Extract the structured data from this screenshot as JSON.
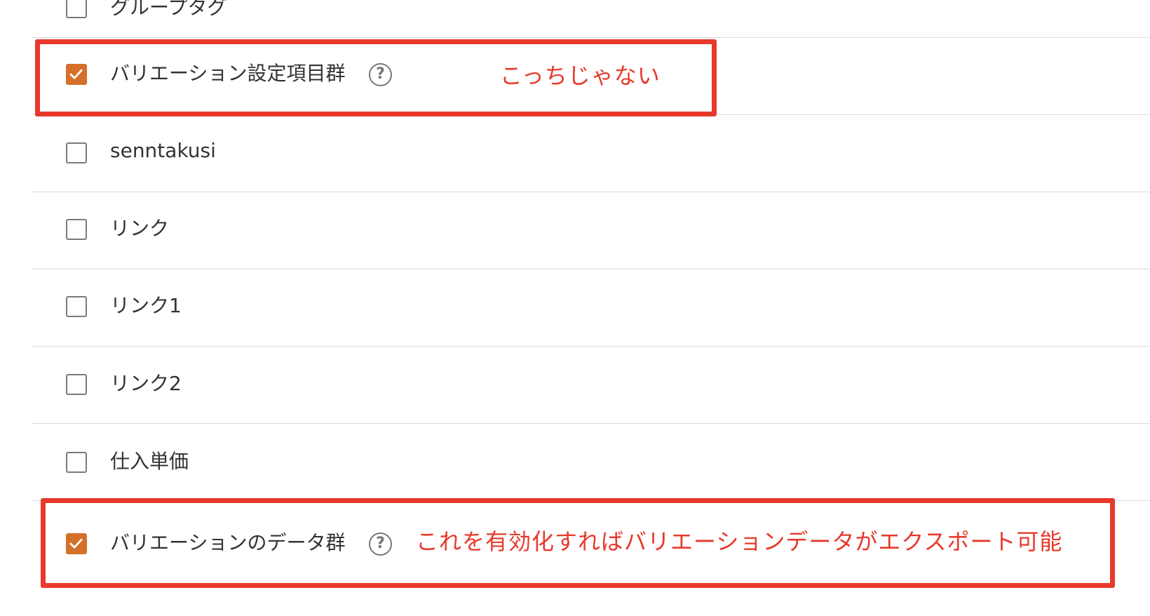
{
  "rows": [
    {
      "label": "グループタグ",
      "checked": false
    },
    {
      "label": "バリエーション設定項目群",
      "checked": true,
      "help": "?"
    },
    {
      "label": "senntakusi",
      "checked": false
    },
    {
      "label": "リンク",
      "checked": false
    },
    {
      "label": "リンク1",
      "checked": false
    },
    {
      "label": "リンク2",
      "checked": false
    },
    {
      "label": "仕入単価",
      "checked": false
    },
    {
      "label": "バリエーションのデータ群",
      "checked": true,
      "help": "?"
    }
  ],
  "annotations": {
    "first": "こっちじゃない",
    "second": "これを有効化すればバリエーションデータがエクスポート可能"
  },
  "colors": {
    "accent": "#d4702a",
    "annotation": "#e8392c"
  }
}
